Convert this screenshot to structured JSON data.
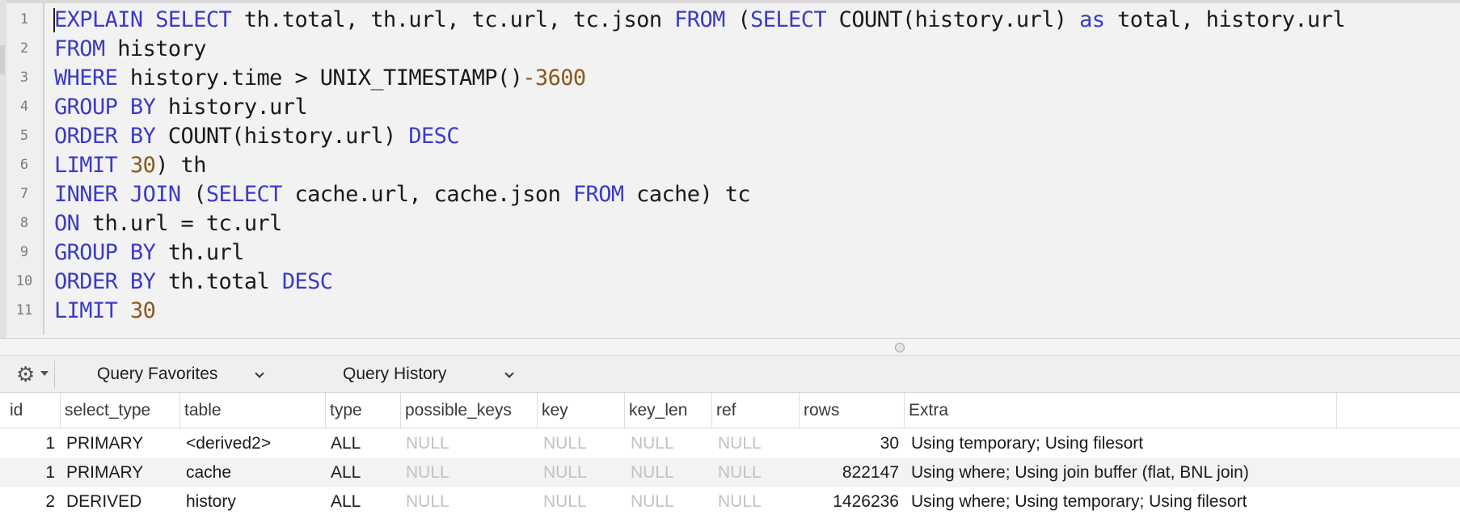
{
  "editor": {
    "lines": [
      {
        "no": "1",
        "tokens": [
          [
            "kw",
            "EXPLAIN SELECT"
          ],
          [
            "t",
            " th.total, th.url, tc.url, tc.json "
          ],
          [
            "kw",
            "FROM"
          ],
          [
            "t",
            " ("
          ],
          [
            "kw",
            "SELECT"
          ],
          [
            "t",
            " COUNT(history.url) "
          ],
          [
            "kw",
            "as"
          ],
          [
            "t",
            " total, history.url"
          ]
        ]
      },
      {
        "no": "2",
        "tokens": [
          [
            "kw",
            "FROM"
          ],
          [
            "t",
            " history"
          ]
        ]
      },
      {
        "no": "3",
        "tokens": [
          [
            "kw",
            "WHERE"
          ],
          [
            "t",
            " history.time > UNIX_TIMESTAMP()"
          ],
          [
            "num",
            "-3600"
          ]
        ]
      },
      {
        "no": "4",
        "tokens": [
          [
            "kw",
            "GROUP BY"
          ],
          [
            "t",
            " history.url"
          ]
        ]
      },
      {
        "no": "5",
        "tokens": [
          [
            "kw",
            "ORDER BY"
          ],
          [
            "t",
            " COUNT(history.url) "
          ],
          [
            "kw",
            "DESC"
          ]
        ]
      },
      {
        "no": "6",
        "tokens": [
          [
            "kw",
            "LIMIT"
          ],
          [
            "t",
            " "
          ],
          [
            "num",
            "30"
          ],
          [
            "t",
            ") th"
          ]
        ]
      },
      {
        "no": "7",
        "tokens": [
          [
            "kw",
            "INNER JOIN"
          ],
          [
            "t",
            " ("
          ],
          [
            "kw",
            "SELECT"
          ],
          [
            "t",
            " cache.url, cache.json "
          ],
          [
            "kw",
            "FROM"
          ],
          [
            "t",
            " cache) tc"
          ]
        ]
      },
      {
        "no": "8",
        "tokens": [
          [
            "kw",
            "ON"
          ],
          [
            "t",
            " th.url = tc.url"
          ]
        ]
      },
      {
        "no": "9",
        "tokens": [
          [
            "kw",
            "GROUP BY"
          ],
          [
            "t",
            " th.url"
          ]
        ]
      },
      {
        "no": "10",
        "tokens": [
          [
            "kw",
            "ORDER BY"
          ],
          [
            "t",
            " th.total "
          ],
          [
            "kw",
            "DESC"
          ]
        ]
      },
      {
        "no": "11",
        "tokens": [
          [
            "kw",
            "LIMIT"
          ],
          [
            "t",
            " "
          ],
          [
            "num",
            "30"
          ]
        ]
      }
    ]
  },
  "toolbar": {
    "gear_icon": "gear-icon",
    "favorites_label": "Query Favorites",
    "history_label": "Query History"
  },
  "results": {
    "columns": [
      "id",
      "select_type",
      "table",
      "type",
      "possible_keys",
      "key",
      "key_len",
      "ref",
      "rows",
      "Extra"
    ],
    "rows": [
      [
        "1",
        "PRIMARY",
        "<derived2>",
        "ALL",
        "NULL",
        "NULL",
        "NULL",
        "NULL",
        "30",
        "Using temporary; Using filesort"
      ],
      [
        "1",
        "PRIMARY",
        "cache",
        "ALL",
        "NULL",
        "NULL",
        "NULL",
        "NULL",
        "822147",
        "Using where; Using join buffer (flat, BNL join)"
      ],
      [
        "2",
        "DERIVED",
        "history",
        "ALL",
        "NULL",
        "NULL",
        "NULL",
        "NULL",
        "1426236",
        "Using where; Using temporary; Using filesort"
      ]
    ]
  },
  "colors": {
    "keyword": "#3b3bc6",
    "number": "#8a5a1a",
    "null_text": "#c2c2c2"
  }
}
